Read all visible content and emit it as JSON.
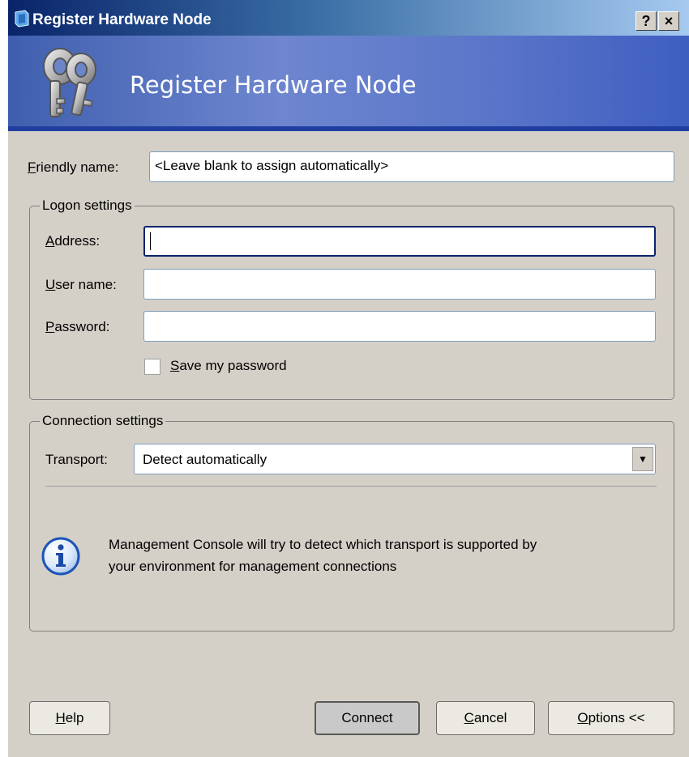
{
  "window": {
    "title": "Register Hardware Node",
    "help_button": "?",
    "close_button": "×"
  },
  "banner": {
    "title": "Register Hardware Node"
  },
  "friendly_name": {
    "label_accel": "F",
    "label_rest": "riendly name:",
    "value": "<Leave blank to assign automatically>"
  },
  "logon": {
    "legend": "Logon settings",
    "address": {
      "label_accel": "A",
      "label_rest": "ddress:",
      "value": ""
    },
    "user_name": {
      "label_accel": "U",
      "label_rest": "ser name:",
      "value": ""
    },
    "password": {
      "label_accel": "P",
      "label_rest": "assword:",
      "value": ""
    },
    "save_password": {
      "label_accel": "S",
      "label_rest": "ave my password",
      "checked": false
    }
  },
  "connection": {
    "legend": "Connection settings",
    "transport_label": "Transport:",
    "transport_value": "Detect automatically",
    "info_icon": "info-icon",
    "info_line1": "Management Console will try to detect which transport is supported by",
    "info_line2": "your environment for management connections"
  },
  "buttons": {
    "help_accel": "H",
    "help_rest": "elp",
    "connect": "Connect",
    "cancel_accel": "C",
    "cancel_rest": "ancel",
    "options_accel": "O",
    "options_rest": "ptions <<"
  },
  "colors": {
    "title_bar": "#0a246a",
    "banner": "#5b76c9",
    "dialog_bg": "#d4d0c8"
  }
}
